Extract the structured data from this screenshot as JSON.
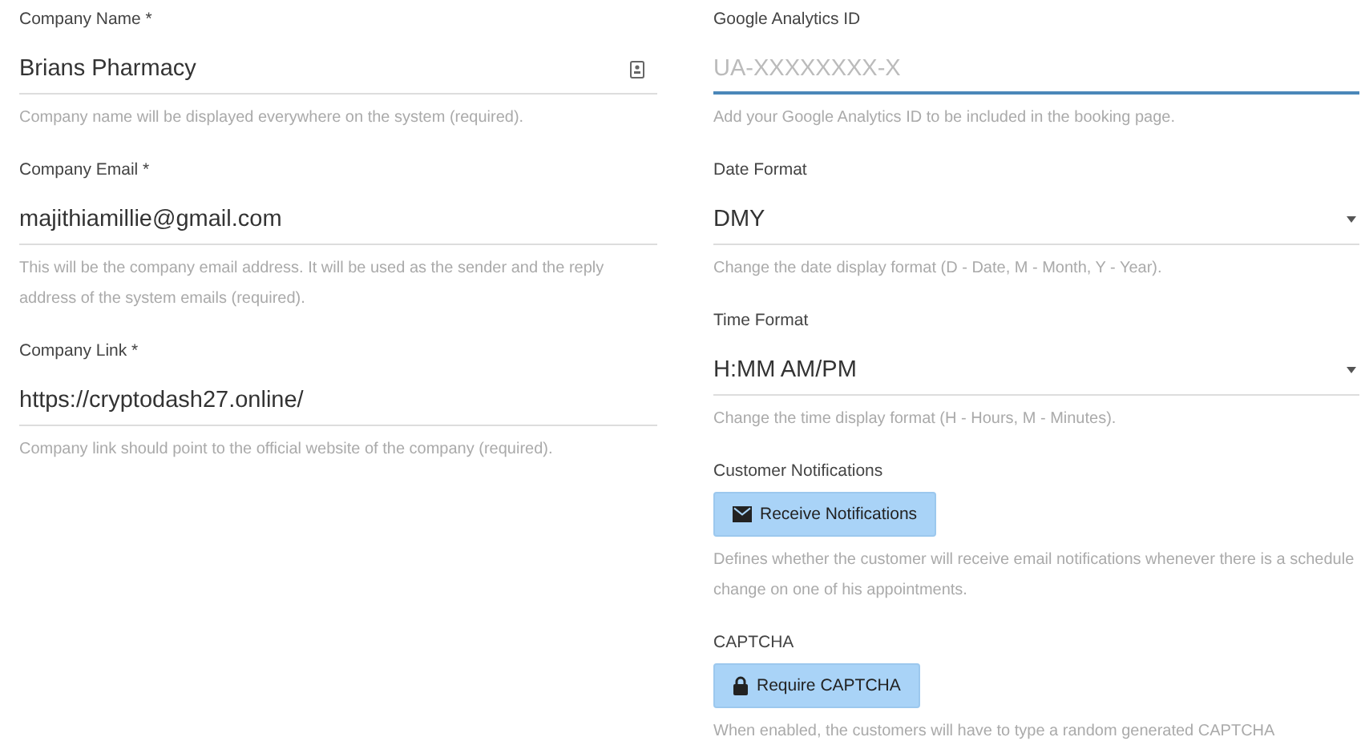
{
  "left_fields": [
    {
      "kind": "text",
      "label": "Company Name *",
      "value": "Brians Pharmacy",
      "has_autofill_icon": true,
      "help": "Company name will be displayed everywhere on the system (required)."
    },
    {
      "kind": "text",
      "label": "Company Email *",
      "value": "majithiamillie@gmail.com",
      "help": "This will be the company email address. It will be used as the sender and the reply address of the system emails (required)."
    },
    {
      "kind": "text",
      "label": "Company Link *",
      "value": "https://cryptodash27.online/",
      "help": "Company link should point to the official website of the company (required)."
    }
  ],
  "right_fields": [
    {
      "kind": "text",
      "label": "Google Analytics ID",
      "placeholder": "UA-XXXXXXXX-X",
      "focused": true,
      "help": "Add your Google Analytics ID to be included in the booking page."
    },
    {
      "kind": "select",
      "label": "Date Format",
      "value": "DMY",
      "help": "Change the date display format (D - Date, M - Month, Y - Year)."
    },
    {
      "kind": "select",
      "label": "Time Format",
      "value": "H:MM AM/PM",
      "help": "Change the time display format (H - Hours, M - Minutes)."
    },
    {
      "kind": "toggle",
      "label": "Customer Notifications",
      "button": "Receive Notifications",
      "on": true,
      "help": "Defines whether the customer will receive email notifications whenever there is a schedule change on one of his appointments."
    },
    {
      "kind": "toggle",
      "label": "CAPTCHA",
      "button": "Require CAPTCHA",
      "on": true,
      "help": "When enabled, the customers will have to type a random generated CAPTCHA"
    }
  ]
}
